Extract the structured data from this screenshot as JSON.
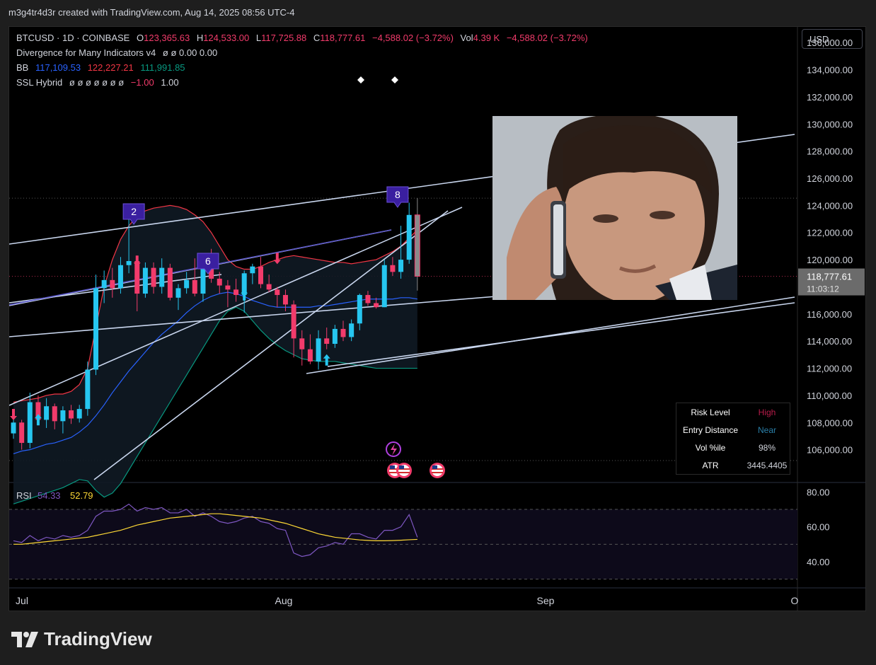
{
  "header": {
    "caption": "m3g4tr4d3r created with TradingView.com, Aug 14, 2025 08:56 UTC-4"
  },
  "legend": {
    "symbol": "BTCUSD · 1D · COINBASE",
    "open_label": "O",
    "open": "123,365.63",
    "high_label": "H",
    "high": "124,533.00",
    "low_label": "L",
    "low": "117,725.88",
    "close_label": "C",
    "close": "118,777.61",
    "change": "−4,588.02 (−3.72%)",
    "vol_label": "Vol",
    "vol": "4.39 K",
    "vol_change": "−4,588.02 (−3.72%)",
    "div_name": "Divergence for Many Indicators v4",
    "div_values": "ø ø 0.00 0.00",
    "bb_name": "BB",
    "bb_basis": "117,109.53",
    "bb_upper": "122,227.21",
    "bb_lower": "111,991.85",
    "ssl_name": "SSL Hybrid",
    "ssl_empty": "ø ø ø ø ø ø ø",
    "ssl_neg": "−1.00",
    "ssl_pos": "1.00"
  },
  "currency": "USD",
  "price_tag": {
    "price": "118,777.61",
    "countdown": "11:03:12"
  },
  "rsi": {
    "label": "RSI",
    "value": "54.33",
    "ma_value": "52.79"
  },
  "info_table": [
    {
      "key": "Risk Level",
      "value": "High",
      "color": "#b71c4a"
    },
    {
      "key": "Entry Distance",
      "value": "Near",
      "color": "#2a7fa8"
    },
    {
      "key": "Vol %ile",
      "value": "98%",
      "color": "#ffffff"
    },
    {
      "key": "ATR",
      "value": "3445.4405",
      "color": "#ffffff"
    }
  ],
  "markers": [
    "2",
    "6",
    "8"
  ],
  "brand": {
    "name": "TradingView"
  },
  "colors": {
    "up": "#26c6f0",
    "down": "#f23b6b",
    "bb_upper": "#f23645",
    "bb_basis": "#2962ff",
    "bb_lower": "#089981",
    "rsi": "#7e57c2",
    "rsi_ma": "#fdd835",
    "marker": "#3a1fa0"
  },
  "chart_data": {
    "type": "candlestick",
    "price_axis": {
      "min": 104000,
      "max": 137000,
      "ticks": [
        "136,000.00",
        "134,000.00",
        "132,000.00",
        "130,000.00",
        "128,000.00",
        "126,000.00",
        "124,000.00",
        "122,000.00",
        "120,000.00",
        "118,000.00",
        "116,000.00",
        "114,000.00",
        "112,000.00",
        "110,000.00",
        "108,000.00",
        "106,000.00"
      ]
    },
    "time_axis": {
      "labels": [
        "Jul",
        "Aug",
        "Sep",
        "O"
      ]
    },
    "candles": [
      [
        107200,
        108400,
        106800,
        108000
      ],
      [
        108000,
        108200,
        106000,
        106500
      ],
      [
        106500,
        110200,
        106100,
        109500
      ],
      [
        109500,
        110000,
        107800,
        108200
      ],
      [
        108200,
        109800,
        107600,
        109200
      ],
      [
        109200,
        109400,
        107500,
        108100
      ],
      [
        108100,
        109200,
        107200,
        108900
      ],
      [
        108900,
        109300,
        107900,
        108300
      ],
      [
        108300,
        109300,
        108000,
        109000
      ],
      [
        109000,
        112500,
        108500,
        111900
      ],
      [
        111900,
        118900,
        111500,
        117900
      ],
      [
        117900,
        119200,
        116800,
        118500
      ],
      [
        118500,
        119400,
        117200,
        117900
      ],
      [
        117900,
        120200,
        117500,
        119600
      ],
      [
        119600,
        123200,
        119000,
        119900
      ],
      [
        119900,
        120300,
        116200,
        117500
      ],
      [
        117500,
        119800,
        117200,
        119400
      ],
      [
        119400,
        119800,
        117500,
        118000
      ],
      [
        118000,
        120100,
        117500,
        119400
      ],
      [
        119400,
        119700,
        117000,
        117200
      ],
      [
        117200,
        118200,
        116300,
        117900
      ],
      [
        117900,
        119100,
        117500,
        118500
      ],
      [
        118500,
        120100,
        117300,
        117500
      ],
      [
        117500,
        120000,
        116900,
        119900
      ],
      [
        119900,
        120800,
        118300,
        118600
      ],
      [
        118600,
        119100,
        117500,
        118100
      ],
      [
        118100,
        118500,
        116500,
        117800
      ],
      [
        117800,
        118600,
        116900,
        117400
      ],
      [
        117400,
        119200,
        116100,
        119000
      ],
      [
        119000,
        119700,
        118200,
        119500
      ],
      [
        119500,
        120200,
        117900,
        118200
      ],
      [
        118200,
        118900,
        117600,
        117800
      ],
      [
        117800,
        118000,
        116500,
        117400
      ],
      [
        117400,
        117800,
        116200,
        116700
      ],
      [
        116700,
        117000,
        112800,
        114200
      ],
      [
        114200,
        114800,
        112200,
        113400
      ],
      [
        113400,
        114500,
        112300,
        112500
      ],
      [
        112500,
        114800,
        111900,
        114200
      ],
      [
        114200,
        115000,
        113400,
        113800
      ],
      [
        113800,
        115200,
        113500,
        114900
      ],
      [
        114900,
        115500,
        114000,
        114300
      ],
      [
        114300,
        115600,
        114000,
        115300
      ],
      [
        115300,
        117500,
        114800,
        117400
      ],
      [
        117400,
        117700,
        116600,
        116800
      ],
      [
        116800,
        117200,
        116400,
        116500
      ],
      [
        116500,
        120000,
        116500,
        119600
      ],
      [
        119600,
        120200,
        118800,
        119100
      ],
      [
        119100,
        122500,
        118600,
        120000
      ],
      [
        120000,
        124200,
        119700,
        123300
      ],
      [
        123300,
        124533,
        117726,
        118778
      ]
    ],
    "bollinger": {
      "upper": [
        109500,
        109600,
        109700,
        109800,
        110000,
        110100,
        110100,
        110300,
        110800,
        112000,
        115000,
        118000,
        120000,
        121500,
        122500,
        123200,
        123600,
        123800,
        123900,
        124000,
        123900,
        123700,
        123300,
        122800,
        122000,
        121000,
        120000,
        119500,
        119300,
        119300,
        119500,
        119800,
        120000,
        120200,
        120300,
        120200,
        120100,
        120000,
        119900,
        119800,
        119800,
        119700,
        119800,
        119900,
        120000,
        120300,
        120600,
        121000,
        121600,
        122200
      ],
      "basis": [
        105700,
        105900,
        106000,
        106200,
        106400,
        106500,
        106700,
        106900,
        107300,
        107800,
        108500,
        109300,
        110200,
        111000,
        111800,
        112500,
        113200,
        113900,
        114500,
        115000,
        115500,
        116100,
        116600,
        117000,
        117300,
        117500,
        117600,
        117500,
        117300,
        117000,
        116800,
        116600,
        116500,
        116500,
        116500,
        116500,
        116500,
        116600,
        116600,
        116700,
        116800,
        116900,
        117000,
        117100,
        117100,
        117100,
        117100,
        117200,
        117200,
        117100
      ],
      "lower": [
        102000,
        102200,
        102400,
        102600,
        102800,
        103000,
        103200,
        103500,
        103800,
        103700,
        103000,
        102500,
        102800,
        103500,
        104500,
        105500,
        106500,
        107500,
        108500,
        109500,
        110500,
        111500,
        112500,
        113500,
        114500,
        115500,
        116200,
        116500,
        116200,
        115500,
        114800,
        114200,
        113700,
        113300,
        113000,
        112700,
        112600,
        112500,
        112500,
        112500,
        112400,
        112300,
        112200,
        112100,
        112000,
        112000,
        112000,
        112000,
        112000,
        112000
      ]
    },
    "rsi_series": [
      52,
      51,
      55,
      52,
      54,
      53,
      55,
      54,
      55,
      58,
      66,
      69,
      69,
      70,
      73,
      69,
      71,
      70,
      71,
      68,
      68,
      70,
      66,
      68,
      66,
      63,
      62,
      63,
      65,
      66,
      63,
      62,
      59,
      58,
      45,
      43,
      44,
      48,
      49,
      51,
      50,
      56,
      56,
      54,
      53,
      58,
      58,
      60,
      67,
      54
    ],
    "rsi_ma_series": [
      50,
      50,
      50.5,
      51,
      51.5,
      52,
      52.5,
      53,
      53.5,
      54,
      55,
      56,
      57,
      58,
      59.5,
      61,
      62,
      63,
      64,
      65,
      65.5,
      66,
      66.5,
      67,
      67.5,
      67.5,
      67,
      66.5,
      66,
      65.5,
      65,
      64,
      63,
      62,
      60.5,
      59,
      57.5,
      56,
      55,
      54,
      53.5,
      53,
      52.5,
      52.2,
      52,
      52,
      52.1,
      52.3,
      52.6,
      52.8
    ],
    "rsi_axis": {
      "ticks": [
        "80.00",
        "60.00",
        "40.00"
      ]
    }
  }
}
